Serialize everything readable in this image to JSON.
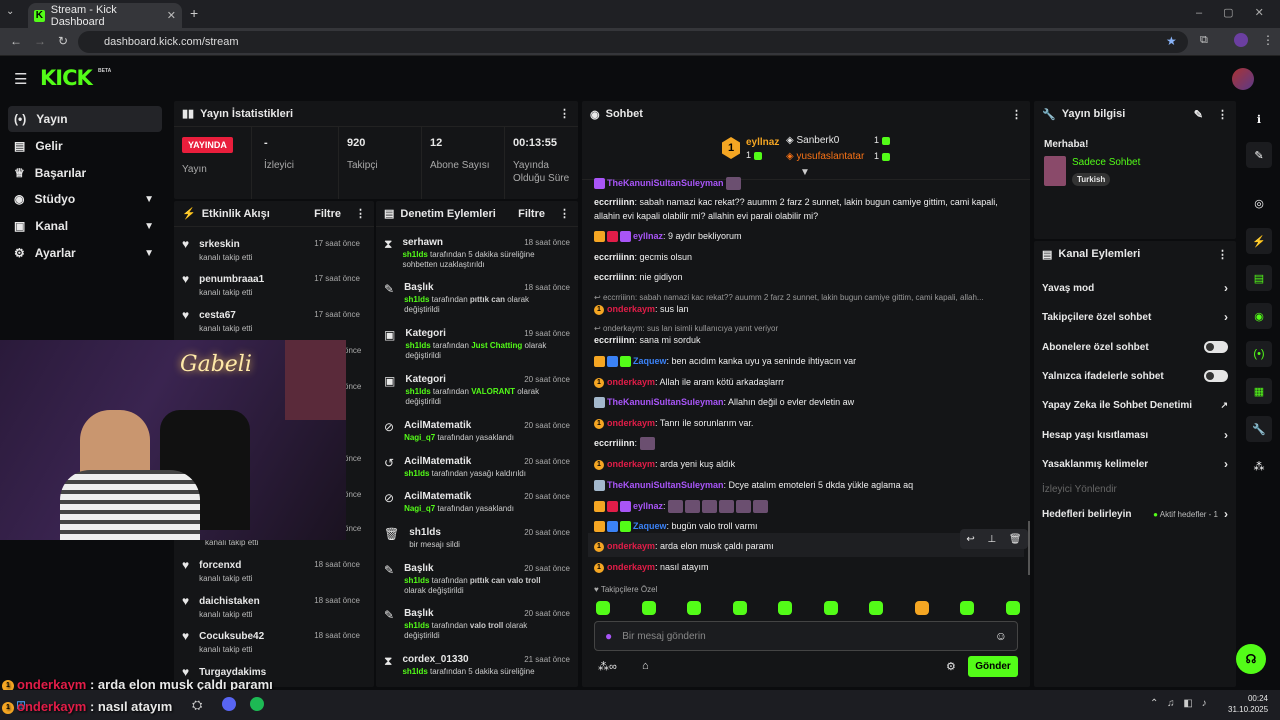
{
  "browser": {
    "tab_title": "Stream - Kick Dashboard",
    "url": "dashboard.kick.com/stream"
  },
  "brand": {
    "logo": "KICK",
    "beta": "BETA",
    "accent": "#53fc18"
  },
  "nav": {
    "items": [
      {
        "label": "Yayın",
        "icon": "stream-icon"
      },
      {
        "label": "Gelir",
        "icon": "wallet-icon"
      },
      {
        "label": "Başarılar",
        "icon": "trophy-icon"
      },
      {
        "label": "Stüdyo",
        "icon": "studio-icon"
      },
      {
        "label": "Kanal",
        "icon": "channel-icon"
      },
      {
        "label": "Ayarlar",
        "icon": "gear-icon"
      }
    ]
  },
  "stats": {
    "title": "Yayın İstatistikleri",
    "live": "YAYINDA",
    "live_label": "Yayın",
    "viewers": "-",
    "viewers_label": "İzleyici",
    "followers": "920",
    "followers_label": "Takipçi",
    "subs": "12",
    "subs_label": "Abone Sayısı",
    "uptime": "00:13:55",
    "uptime_label": "Yayında Olduğu Süre"
  },
  "activity": {
    "title": "Etkinlik Akışı",
    "filter": "Filtre",
    "items": [
      {
        "name": "srkeskin",
        "desc": "kanalı takip etti",
        "time": "17 saat önce"
      },
      {
        "name": "penumbraaa1",
        "desc": "kanalı takip etti",
        "time": "17 saat önce"
      },
      {
        "name": "cesta67",
        "desc": "kanalı takip etti",
        "time": "17 saat önce"
      },
      {
        "name": "forcenxd",
        "desc": "kanalı takip etti",
        "time": "18 saat önce"
      },
      {
        "name": "daichistaken",
        "desc": "kanalı takip etti",
        "time": "18 saat önce"
      },
      {
        "name": "Cocuksube42",
        "desc": "kanalı takip etti",
        "time": "18 saat önce"
      },
      {
        "name": "Turgaydakims",
        "desc": "",
        "time": ""
      }
    ],
    "hidden": [
      "önce",
      "önce",
      "önce",
      "önce",
      "önce",
      "kanalı takip etti"
    ]
  },
  "moderation": {
    "title": "Denetim Eylemleri",
    "filter": "Filtre",
    "items": [
      {
        "name": "serhawn",
        "time": "18 saat önce",
        "d1": "sh1lds",
        "d2": "tarafından 5 dakika süreliğine sohbetten uzaklaştırıldı"
      },
      {
        "name": "Başlık",
        "time": "18 saat önce",
        "d1": "sh1lds",
        "d2": "tarafından",
        "d3": "pıttık can",
        "d4": "olarak değiştirildi"
      },
      {
        "name": "Kategori",
        "time": "19 saat önce",
        "d1": "sh1lds",
        "d2": "tarafından",
        "d3": "Just Chatting",
        "d4": "olarak değiştirildi"
      },
      {
        "name": "Kategori",
        "time": "20 saat önce",
        "d1": "sh1lds",
        "d2": "tarafından",
        "d3": "VALORANT",
        "d4": "olarak değiştirildi"
      },
      {
        "name": "AcilMatematik",
        "time": "20 saat önce",
        "d1": "Nagi_q7",
        "d2": "tarafından yasaklandı"
      },
      {
        "name": "AcilMatematik",
        "time": "20 saat önce",
        "d1": "sh1lds",
        "d2": "tarafından yasağı kaldırıldı"
      },
      {
        "name": "AcilMatematik",
        "time": "20 saat önce",
        "d1": "Nagi_q7",
        "d2": "tarafından yasaklandı"
      },
      {
        "name": "sh1lds",
        "time": "20 saat önce",
        "d2": "bir mesajı sildi"
      },
      {
        "name": "Başlık",
        "time": "20 saat önce",
        "d1": "sh1lds",
        "d2": "tarafından",
        "d3": "pıttık can valo troll",
        "d4": "olarak değiştirildi"
      },
      {
        "name": "Başlık",
        "time": "20 saat önce",
        "d1": "sh1lds",
        "d2": "tarafından",
        "d3": "valo troll",
        "d4": "olarak değiştirildi"
      },
      {
        "name": "cordex_01330",
        "time": "21 saat önce",
        "d1": "sh1lds",
        "d2": "tarafından 5 dakika süreliğine"
      }
    ]
  },
  "chat": {
    "title": "Sohbet",
    "top1": "eyllnaz",
    "top1_count": "1",
    "top2": "Sanberk0",
    "top2_count": "1",
    "top3": "yusufaslantatar",
    "top3_count": "1",
    "rank": "1",
    "messages": [
      {
        "user": "TheKanuniSultanSuleyman",
        "text": ""
      },
      {
        "user": "eccrriiinn",
        "text": ": sabah namazi kac rekat?? auumm 2 farz 2 sunnet, lakin bugun camiye gittim, cami kapali,"
      },
      {
        "user": "",
        "text": "allahin evi kapali olabilir mi? allahin evi parali olabilir mi?"
      },
      {
        "user": "eyllnaz",
        "text": ": 9 aydır bekliyorum"
      },
      {
        "user": "eccrriiinn",
        "text": ": gecmis olsun"
      },
      {
        "user": "eccrriiinn",
        "text": ": nie gidiyon"
      },
      {
        "user": "",
        "text": "eccrriiinn: sabah namazi kac rekat?? auumm 2 farz 2 sunnet, lakin bugun camiye gittim, cami kapali, allah..."
      },
      {
        "user": "onderkaym",
        "text": ": sus lan"
      },
      {
        "user": "",
        "text": "onderkaym: sus lan isimli kullanıcıya yanıt veriyor"
      },
      {
        "user": "eccrriiinn",
        "text": ": sana mi sorduk"
      },
      {
        "user": "Zaquew",
        "text": ": ben acıdım kanka uyu ya seninde ihtiyacın var"
      },
      {
        "user": "onderkaym",
        "text": ": Allah ile aram kötü arkadaşlarrr"
      },
      {
        "user": "TheKanuniSultanSuleyman",
        "text": ": Allahın değil o evler devletin aw"
      },
      {
        "user": "onderkaym",
        "text": ": Tanrı ile sorunlarım var."
      },
      {
        "user": "eccrriiinn",
        "text": ":"
      },
      {
        "user": "onderkaym",
        "text": ": arda yeni kuş aldık"
      },
      {
        "user": "TheKanuniSultanSuleyman",
        "text": ": Dcye atalım emoteleri 5 dkda yükle aglama aq"
      },
      {
        "user": "eyllnaz",
        "text": ":"
      },
      {
        "user": "Zaquew",
        "text": ": bugün valo troll varmı"
      },
      {
        "user": "onderkaym",
        "text": ": arda elon musk çaldı paramı"
      },
      {
        "user": "onderkaym",
        "text": ": nasıl atayım"
      }
    ],
    "emote_label": "Takipçilere Özel",
    "placeholder": "Bir mesaj gönderin",
    "send": "Gönder"
  },
  "stream_info": {
    "title": "Yayın bilgisi",
    "greeting": "Merhaba!",
    "stream_title": "Sadece Sohbet",
    "language": "Turkish"
  },
  "channel_actions": {
    "title": "Kanal Eylemleri",
    "items": [
      "Yavaş mod",
      "Takipçilere özel sohbet",
      "Abonelere özel sohbet",
      "Yalnızca ifadelerle sohbet",
      "Yapay Zeka ile Sohbet Denetimi",
      "Hesap yaşı kısıtlaması",
      "Yasaklanmış kelimeler",
      "İzleyici Yönlendir",
      "Hedefleri belirleyin"
    ],
    "goals_status": "Aktif hedefler - 1"
  },
  "overlay": {
    "webcam_sign": "Gabeli",
    "line1_user": "onderkaym",
    "line1_text": " : arda elon musk çaldı paramı",
    "line2_user": "onderkaym",
    "line2_text": " : nasıl atayım"
  },
  "taskbar": {
    "time": "00:24",
    "date": "31.10.2025"
  }
}
